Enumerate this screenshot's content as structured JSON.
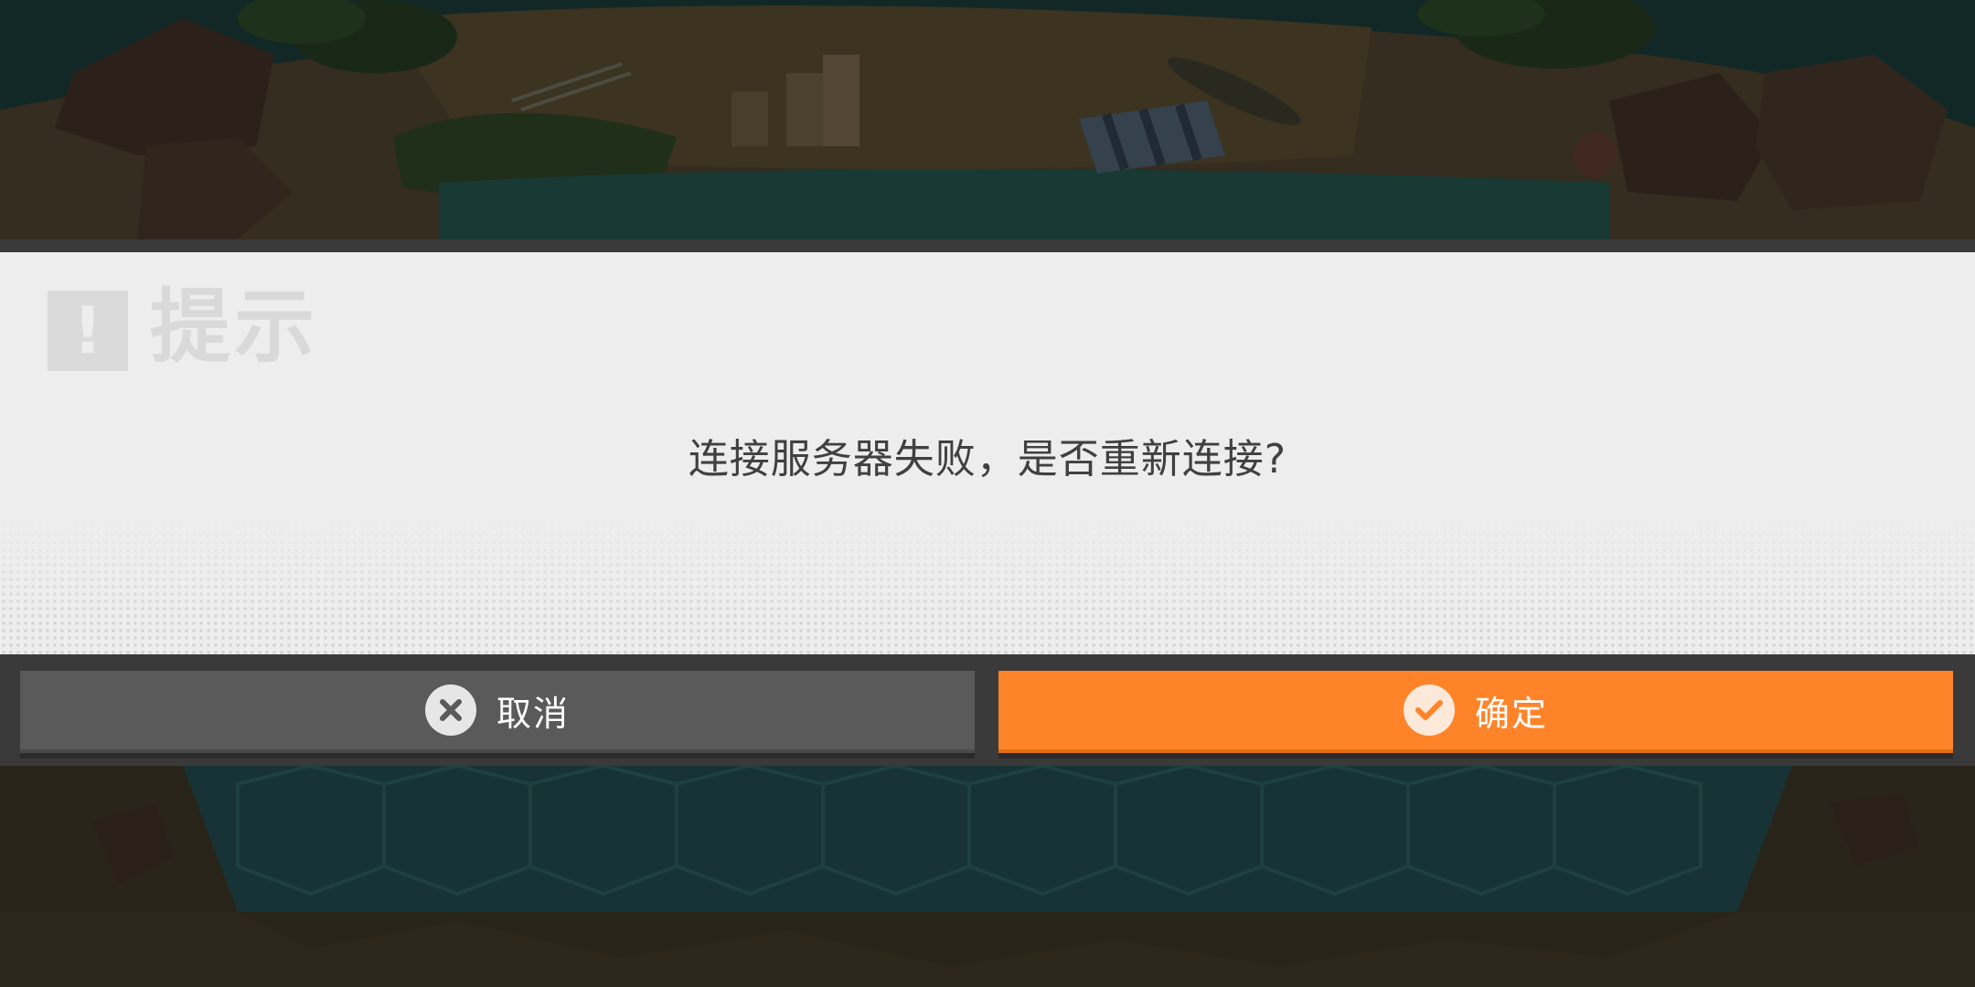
{
  "dialog": {
    "title": "提示",
    "title_icon": "exclamation-icon",
    "title_icon_glyph": "!",
    "message": "连接服务器失败，是否重新连接?",
    "cancel_label": "取消",
    "cancel_icon": "close-icon",
    "confirm_label": "确定",
    "confirm_icon": "check-icon"
  },
  "colors": {
    "panel_background": "#ededed",
    "bar_background": "#3a3a3a",
    "cancel_button": "#5a5a5a",
    "confirm_button": "#ff8429",
    "message_text": "#404040",
    "title_text": "#d9d9d9"
  }
}
